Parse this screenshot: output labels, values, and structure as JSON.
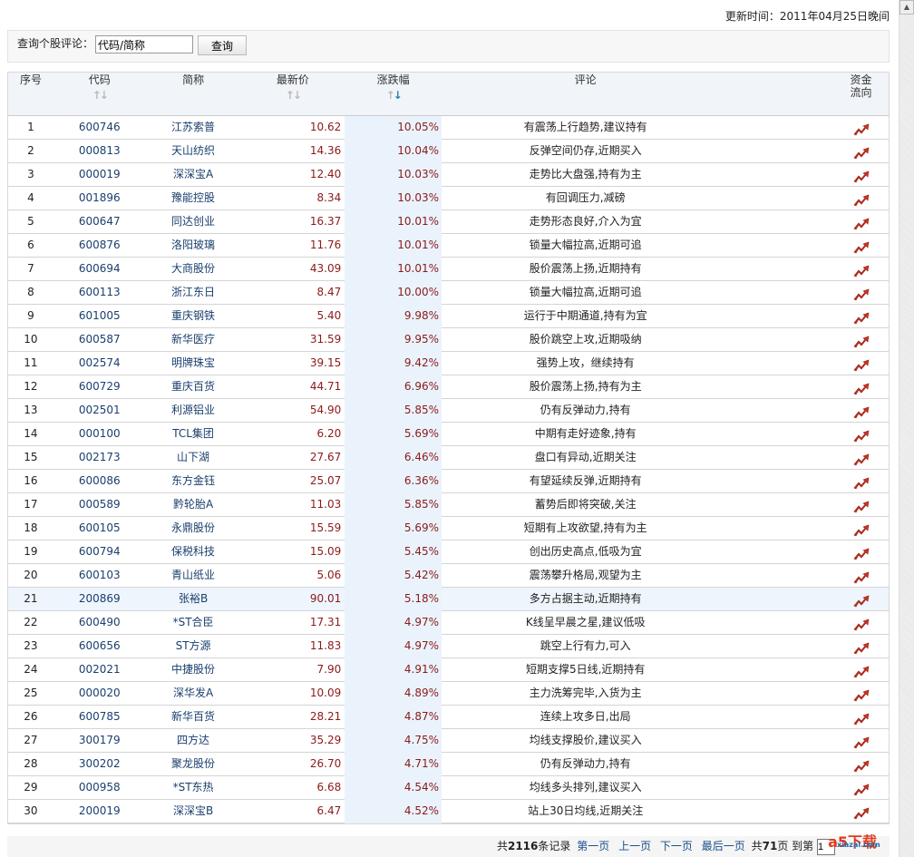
{
  "update_time": "更新时间：2011年04月25日晚间",
  "search": {
    "label": "查询个股评论：",
    "value": "代码/简称",
    "button": "查询"
  },
  "headers": {
    "idx": "序号",
    "code": "代码",
    "name": "简称",
    "price": "最新价",
    "pct": "涨跌幅",
    "comment": "评论",
    "flow1": "资金",
    "flow2": "流向",
    "sort_arrows": "↑↓"
  },
  "sort": {
    "column": "涨跌幅",
    "direction": "desc"
  },
  "colors": {
    "accent": "#1a3f6e",
    "up": "#8b1a1a",
    "highlight": "#eaf3fc"
  },
  "rows": [
    {
      "idx": "1",
      "code": "600746",
      "name": "江苏索普",
      "price": "10.62",
      "pct": "10.05%",
      "comment": "有震荡上行趋势,建议持有"
    },
    {
      "idx": "2",
      "code": "000813",
      "name": "天山纺织",
      "price": "14.36",
      "pct": "10.04%",
      "comment": "反弹空间仍存,近期买入"
    },
    {
      "idx": "3",
      "code": "000019",
      "name": "深深宝A",
      "price": "12.40",
      "pct": "10.03%",
      "comment": "走势比大盘强,持有为主"
    },
    {
      "idx": "4",
      "code": "001896",
      "name": "豫能控股",
      "price": "8.34",
      "pct": "10.03%",
      "comment": "有回调压力,减磅"
    },
    {
      "idx": "5",
      "code": "600647",
      "name": "同达创业",
      "price": "16.37",
      "pct": "10.01%",
      "comment": "走势形态良好,介入为宜"
    },
    {
      "idx": "6",
      "code": "600876",
      "name": "洛阳玻璃",
      "price": "11.76",
      "pct": "10.01%",
      "comment": "锁量大幅拉高,近期可追"
    },
    {
      "idx": "7",
      "code": "600694",
      "name": "大商股份",
      "price": "43.09",
      "pct": "10.01%",
      "comment": "股价震荡上扬,近期持有"
    },
    {
      "idx": "8",
      "code": "600113",
      "name": "浙江东日",
      "price": "8.47",
      "pct": "10.00%",
      "comment": "锁量大幅拉高,近期可追"
    },
    {
      "idx": "9",
      "code": "601005",
      "name": "重庆钢铁",
      "price": "5.40",
      "pct": "9.98%",
      "comment": "运行于中期通道,持有为宜"
    },
    {
      "idx": "10",
      "code": "600587",
      "name": "新华医疗",
      "price": "31.59",
      "pct": "9.95%",
      "comment": "股价跳空上攻,近期吸纳"
    },
    {
      "idx": "11",
      "code": "002574",
      "name": "明牌珠宝",
      "price": "39.15",
      "pct": "9.42%",
      "comment": "强势上攻，继续持有"
    },
    {
      "idx": "12",
      "code": "600729",
      "name": "重庆百货",
      "price": "44.71",
      "pct": "6.96%",
      "comment": "股价震荡上扬,持有为主"
    },
    {
      "idx": "13",
      "code": "002501",
      "name": "利源铝业",
      "price": "54.90",
      "pct": "5.85%",
      "comment": "仍有反弹动力,持有"
    },
    {
      "idx": "14",
      "code": "000100",
      "name": "TCL集团",
      "price": "6.20",
      "pct": "5.69%",
      "comment": "中期有走好迹象,持有"
    },
    {
      "idx": "15",
      "code": "002173",
      "name": "山下湖",
      "price": "27.67",
      "pct": "6.46%",
      "comment": "盘口有异动,近期关注"
    },
    {
      "idx": "16",
      "code": "600086",
      "name": "东方金钰",
      "price": "25.07",
      "pct": "6.36%",
      "comment": "有望延续反弹,近期持有"
    },
    {
      "idx": "17",
      "code": "000589",
      "name": "黔轮胎A",
      "price": "11.03",
      "pct": "5.85%",
      "comment": "蓄势后即将突破,关注"
    },
    {
      "idx": "18",
      "code": "600105",
      "name": "永鼎股份",
      "price": "15.59",
      "pct": "5.69%",
      "comment": "短期有上攻欲望,持有为主"
    },
    {
      "idx": "19",
      "code": "600794",
      "name": "保税科技",
      "price": "15.09",
      "pct": "5.45%",
      "comment": "创出历史高点,低吸为宜"
    },
    {
      "idx": "20",
      "code": "600103",
      "name": "青山纸业",
      "price": "5.06",
      "pct": "5.42%",
      "comment": "震荡攀升格局,观望为主"
    },
    {
      "idx": "21",
      "code": "200869",
      "name": "张裕B",
      "price": "90.01",
      "pct": "5.18%",
      "comment": "多方占据主动,近期持有"
    },
    {
      "idx": "22",
      "code": "600490",
      "name": "*ST合臣",
      "price": "17.31",
      "pct": "4.97%",
      "comment": "K线呈早晨之星,建议低吸"
    },
    {
      "idx": "23",
      "code": "600656",
      "name": "ST方源",
      "price": "11.83",
      "pct": "4.97%",
      "comment": "跳空上行有力,可入"
    },
    {
      "idx": "24",
      "code": "002021",
      "name": "中捷股份",
      "price": "7.90",
      "pct": "4.91%",
      "comment": "短期支撑5日线,近期持有"
    },
    {
      "idx": "25",
      "code": "000020",
      "name": "深华发A",
      "price": "10.09",
      "pct": "4.89%",
      "comment": "主力洗筹完毕,入货为主"
    },
    {
      "idx": "26",
      "code": "600785",
      "name": "新华百货",
      "price": "28.21",
      "pct": "4.87%",
      "comment": "连续上攻多日,出局"
    },
    {
      "idx": "27",
      "code": "300179",
      "name": "四方达",
      "price": "35.29",
      "pct": "4.75%",
      "comment": "均线支撑股价,建议买入"
    },
    {
      "idx": "28",
      "code": "300202",
      "name": "聚龙股份",
      "price": "26.70",
      "pct": "4.71%",
      "comment": "仍有反弹动力,持有"
    },
    {
      "idx": "29",
      "code": "000958",
      "name": "*ST东热",
      "price": "6.68",
      "pct": "4.54%",
      "comment": "均线多头排列,建议买入"
    },
    {
      "idx": "30",
      "code": "200019",
      "name": "深深宝B",
      "price": "6.47",
      "pct": "4.52%",
      "comment": "站上30日均线,近期关注"
    }
  ],
  "highlighted_row": 21,
  "pager": {
    "total_prefix": "共",
    "total_records": "2116",
    "total_suffix": "条记录",
    "first": "第一页",
    "prev": "上一页",
    "next": "下一页",
    "last": "最后一页",
    "pages_prefix": "共",
    "total_pages": "71",
    "pages_suffix": "页",
    "goto": "到第",
    "goto_value": "1"
  },
  "watermark": {
    "brand": "a5下载",
    "site": "xiazai.com"
  }
}
